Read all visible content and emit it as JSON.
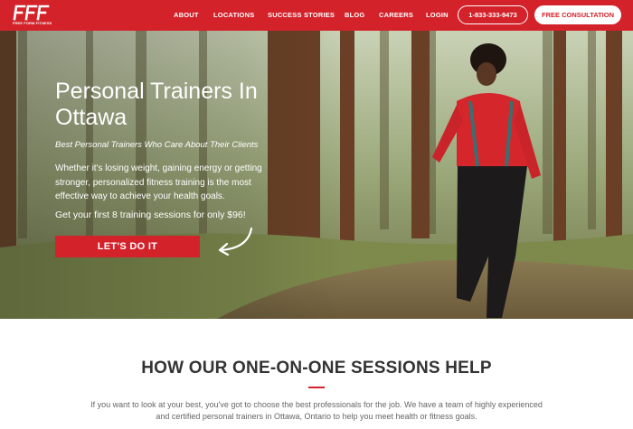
{
  "brand": {
    "logo_text": "FREE FORM FITNESS",
    "accent_color": "#d3222a"
  },
  "nav": {
    "items": [
      "ABOUT",
      "LOCATIONS",
      "SUCCESS STORIES",
      "BLOG",
      "CAREERS",
      "LOGIN"
    ],
    "phone": "1-833-333-9473",
    "consultation": "FREE CONSULTATION"
  },
  "hero": {
    "title": "Personal Trainers In Ottawa",
    "subtitle": "Best Personal Trainers Who Care About Their Clients",
    "body": "Whether it's losing weight, gaining energy or getting stronger, personalized fitness training is the most effective way to achieve your health goals.",
    "offer": "Get your first 8 training sessions for only $96!",
    "cta": "LET'S DO IT",
    "arrow_icon": "curved-arrow-icon"
  },
  "section": {
    "title": "HOW OUR ONE-ON-ONE SESSIONS HELP",
    "body": "If you want to look at your best, you've got to choose the best professionals for the job. We have a team of highly experienced and certified personal trainers in Ottawa, Ontario to help you meet health or fitness goals."
  }
}
